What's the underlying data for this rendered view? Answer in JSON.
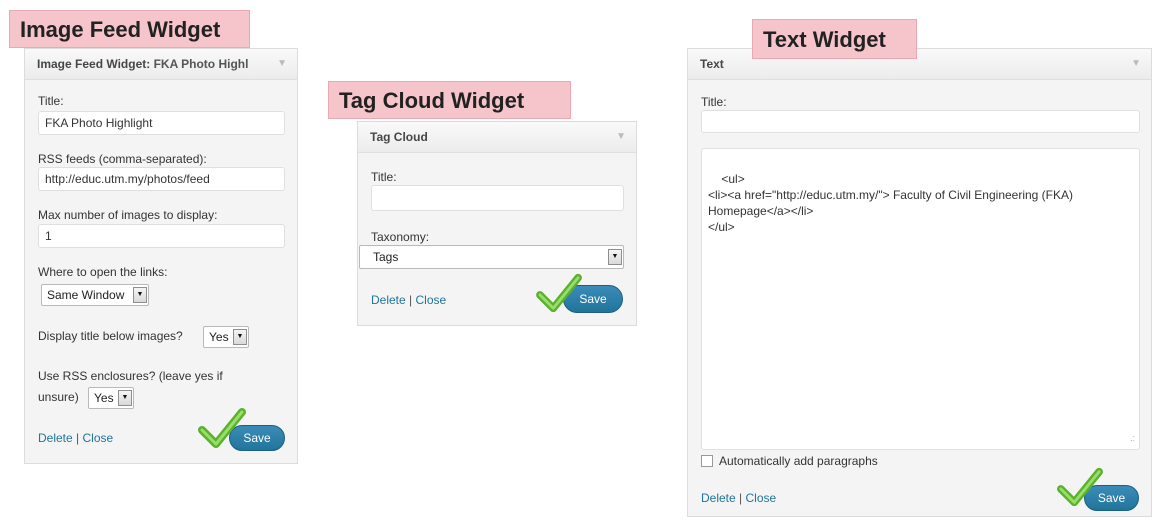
{
  "callouts": {
    "image_feed": "Image Feed Widget",
    "tag_cloud": "Tag Cloud Widget",
    "text": "Text Widget"
  },
  "image_feed_widget": {
    "header_prefix": "Image Feed Widget:",
    "header_name": " FKA Photo Highl",
    "title_label": "Title:",
    "title_value": "FKA Photo Highlight",
    "rss_label": "RSS feeds (comma-separated):",
    "rss_value": "http://educ.utm.my/photos/feed",
    "max_label": "Max number of images to display:",
    "max_value": "1",
    "open_label": "Where to open the links:",
    "open_value": "Same Window",
    "display_title_label": "Display title below images?",
    "display_title_value": "Yes",
    "enclosures_label_1": "Use RSS enclosures? (leave yes if",
    "enclosures_label_2": "unsure)",
    "enclosures_value": "Yes",
    "delete": "Delete",
    "sep": " | ",
    "close": "Close",
    "save": "Save"
  },
  "tag_cloud_widget": {
    "header": "Tag Cloud",
    "title_label": "Title:",
    "title_value": "",
    "taxonomy_label": "Taxonomy:",
    "taxonomy_value": "Tags",
    "delete": "Delete",
    "sep": " | ",
    "close": "Close",
    "save": "Save"
  },
  "text_widget": {
    "header": "Text",
    "title_label": "Title:",
    "title_value": "",
    "content": "<ul>\n<li><a href=\"http://educ.utm.my/\"> Faculty of Civil Engineering (FKA)\nHomepage</a></li>\n</ul>",
    "auto_paragraphs_label": "Automatically add paragraphs",
    "auto_paragraphs_checked": false,
    "delete": "Delete",
    "sep": " | ",
    "close": "Close",
    "save": "Save"
  },
  "icons": {
    "checkmark": "checkmark-icon",
    "arrow": "triangle-down-icon"
  },
  "colors": {
    "link": "#21759b",
    "save_button": "#21759b",
    "callout_bg": "#f6c5cb",
    "checkmark": "#59b22b"
  }
}
